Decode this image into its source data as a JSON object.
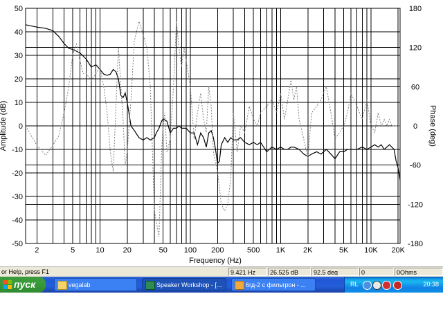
{
  "window": {
    "app_name": "Speaker Workshop"
  },
  "chart_data": {
    "type": "line",
    "xlabel": "Frequency (Hz)",
    "ylabel": "Amplitude (dB)",
    "y2label": "Phase (deg)",
    "x_scale": "log",
    "xlim": [
      1.5,
      21000
    ],
    "ylim": [
      -50,
      50
    ],
    "y2lim": [
      -180,
      180
    ],
    "grid": true,
    "x_ticks": [
      {
        "value": 2,
        "label": "2"
      },
      {
        "value": 5,
        "label": "5"
      },
      {
        "value": 10,
        "label": "10"
      },
      {
        "value": 20,
        "label": "20"
      },
      {
        "value": 50,
        "label": "50"
      },
      {
        "value": 100,
        "label": "100"
      },
      {
        "value": 200,
        "label": "200"
      },
      {
        "value": 500,
        "label": "500"
      },
      {
        "value": 1000,
        "label": "1K"
      },
      {
        "value": 2000,
        "label": "2K"
      },
      {
        "value": 5000,
        "label": "5K"
      },
      {
        "value": 10000,
        "label": "10K"
      },
      {
        "value": 20000,
        "label": "20K"
      }
    ],
    "y_ticks": [
      50,
      40,
      30,
      20,
      10,
      0,
      -10,
      -20,
      -30,
      -40,
      -50
    ],
    "y2_ticks": [
      180,
      120,
      60,
      0,
      -60,
      -120,
      -180
    ],
    "series": [
      {
        "axis": "left",
        "color": "#000000",
        "style": "solid",
        "x": [
          1.5,
          2,
          2.5,
          3,
          3.5,
          4,
          4.5,
          5,
          6,
          7,
          8,
          9,
          10,
          11,
          12,
          13,
          14,
          15,
          16,
          17,
          18,
          19,
          20,
          21,
          22,
          24,
          27,
          30,
          33,
          36,
          40,
          42,
          45,
          48,
          50,
          55,
          60,
          65,
          70,
          75,
          80,
          90,
          100,
          110,
          120,
          130,
          140,
          150,
          160,
          170,
          180,
          190,
          200,
          210,
          220,
          240,
          260,
          280,
          300,
          330,
          360,
          400,
          450,
          500,
          550,
          600,
          700,
          800,
          900,
          1000,
          1100,
          1200,
          1300,
          1400,
          1600,
          1800,
          2000,
          2200,
          2500,
          2800,
          3200,
          3600,
          4000,
          4500,
          5000,
          5500,
          6000,
          7000,
          8000,
          9000,
          10000,
          11000,
          12000,
          13000,
          14000,
          15000,
          16000,
          17000,
          18000,
          19000,
          20000,
          21000
        ],
        "y": [
          43,
          42,
          41.5,
          40.5,
          38,
          35,
          33,
          32.5,
          31,
          28.5,
          25,
          26,
          24,
          22,
          21.5,
          22,
          24,
          23,
          20,
          13,
          12,
          14,
          10,
          5,
          0,
          -2,
          -5,
          -6,
          -5,
          -6,
          -5,
          -3,
          -1,
          2,
          3,
          2,
          -3,
          -1,
          -1,
          0,
          -1,
          -1,
          -3,
          -3,
          -8,
          -3,
          -5,
          -9,
          -3,
          -2,
          -5,
          -10,
          -16,
          -15,
          -8,
          -5,
          -7,
          -5,
          -6,
          -6,
          -5,
          -7,
          -8,
          -7,
          -8,
          -7,
          -11,
          -9,
          -10,
          -9,
          -10,
          -10,
          -9,
          -9,
          -10,
          -12,
          -13,
          -12,
          -11,
          -12,
          -10,
          -12,
          -14,
          -11,
          -11,
          -10,
          -10,
          -10,
          -9,
          -10,
          -9,
          -8,
          -9,
          -8,
          -10,
          -9,
          -8,
          -9,
          -10,
          -15,
          -18,
          -23
        ]
      },
      {
        "axis": "right",
        "color": "#808080",
        "style": "dotted",
        "x": [
          1.5,
          2,
          2.5,
          3,
          3.5,
          4,
          4.5,
          5,
          5.5,
          6,
          6.5,
          7,
          8,
          9,
          10,
          11,
          12,
          13,
          14,
          15,
          16,
          17,
          18,
          19,
          20,
          22,
          24,
          27,
          30,
          33,
          36,
          40,
          45,
          48,
          50,
          52,
          55,
          60,
          65,
          70,
          75,
          80,
          85,
          90,
          100,
          110,
          120,
          130,
          140,
          150,
          160,
          170,
          180,
          200,
          220,
          240,
          260,
          280,
          300,
          330,
          360,
          400,
          450,
          500,
          550,
          600,
          700,
          800,
          900,
          1000,
          1100,
          1200,
          1300,
          1400,
          1500,
          1600,
          1800,
          2000,
          2200,
          2500,
          2800,
          3200,
          3600,
          4000,
          4500,
          5000,
          5500,
          6000,
          7000,
          8000,
          9000,
          10000,
          11000,
          12000,
          13000,
          14000,
          15000,
          16000,
          17000,
          18000,
          19000,
          20000,
          21000
        ],
        "y": [
          0,
          -30,
          -45,
          -30,
          -15,
          20,
          60,
          110,
          125,
          100,
          80,
          80,
          70,
          80,
          90,
          60,
          20,
          -40,
          -70,
          30,
          120,
          60,
          10,
          -60,
          -40,
          40,
          130,
          160,
          140,
          120,
          60,
          -130,
          -170,
          -40,
          0,
          20,
          -40,
          -20,
          60,
          160,
          120,
          90,
          120,
          100,
          60,
          -20,
          20,
          50,
          10,
          -10,
          60,
          30,
          -40,
          -70,
          -120,
          -130,
          -120,
          -80,
          20,
          -40,
          0,
          -10,
          30,
          10,
          0,
          20,
          30,
          40,
          20,
          50,
          10,
          40,
          70,
          40,
          60,
          10,
          -20,
          -50,
          20,
          30,
          40,
          60,
          20,
          -20,
          -10,
          0,
          20,
          50,
          30,
          10,
          40,
          0,
          -10,
          20,
          0,
          10,
          0,
          10,
          0,
          0,
          0,
          0,
          0
        ]
      }
    ]
  },
  "status_bar": {
    "help_text": "or Help, press F1",
    "frequency": "9.421 Hz",
    "amplitude": "26.525 dB",
    "phase": "92.5 deg",
    "count": "0",
    "impedance": "0Ohms"
  },
  "taskbar": {
    "start_label": "пуск",
    "tasks": [
      {
        "label": "vegalab",
        "icon": "folder-icon",
        "active": false
      },
      {
        "label": "Speaker Workshop - [...",
        "icon": "speaker-workshop-icon",
        "active": true
      },
      {
        "label": "6гд-2 с фильтрон - ...",
        "icon": "document-icon",
        "active": false
      }
    ],
    "language": "RL",
    "clock": "20:38",
    "tray_icons": [
      "network-icon",
      "volume-icon",
      "antivirus-icon",
      "security-icon"
    ]
  },
  "colors": {
    "taskbar_blue": "#245edb",
    "start_green": "#3a9b3a",
    "amplitude_line": "#000000",
    "phase_line": "#808080",
    "grid": "#000000"
  }
}
